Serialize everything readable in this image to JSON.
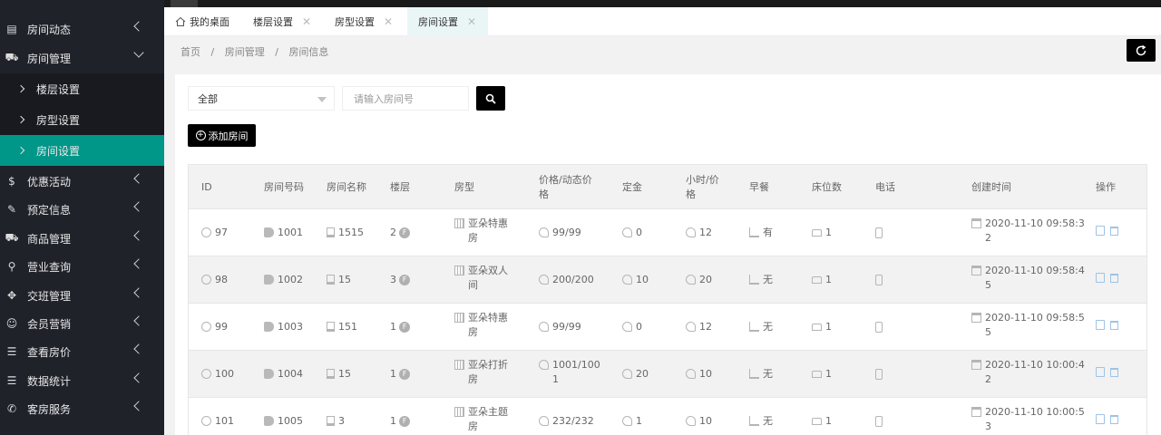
{
  "sidebar": {
    "items": [
      {
        "label": "房间动态",
        "icon": "calendar-icon",
        "expanded": false
      },
      {
        "label": "房间管理",
        "icon": "cart-icon",
        "expanded": true
      },
      {
        "label": "优惠活动",
        "icon": "dollar-icon",
        "expanded": false
      },
      {
        "label": "预定信息",
        "icon": "edit-icon",
        "expanded": false
      },
      {
        "label": "商品管理",
        "icon": "cart-icon",
        "expanded": false
      },
      {
        "label": "营业查询",
        "icon": "search-icon",
        "expanded": false
      },
      {
        "label": "交班管理",
        "icon": "handshake-icon",
        "expanded": false
      },
      {
        "label": "会员营销",
        "icon": "user-icon",
        "expanded": false
      },
      {
        "label": "查看房价",
        "icon": "list-icon",
        "expanded": false
      },
      {
        "label": "数据统计",
        "icon": "list-icon",
        "expanded": false
      },
      {
        "label": "客房服务",
        "icon": "phone-icon",
        "expanded": false
      }
    ],
    "subitems": [
      {
        "label": "楼层设置",
        "active": false
      },
      {
        "label": "房型设置",
        "active": false
      },
      {
        "label": "房间设置",
        "active": true
      }
    ]
  },
  "tabs": [
    {
      "label": "我的桌面",
      "closable": false
    },
    {
      "label": "楼层设置",
      "closable": true
    },
    {
      "label": "房型设置",
      "closable": true
    },
    {
      "label": "房间设置",
      "closable": true,
      "active": true
    }
  ],
  "breadcrumb": [
    "首页",
    "房间管理",
    "房间信息"
  ],
  "breadcrumb_sep": "/",
  "filters": {
    "select_value": "全部",
    "search_placeholder": "请输入房间号"
  },
  "add_button_label": "添加房间",
  "table": {
    "headers": {
      "id": "ID",
      "room_no": "房间号码",
      "room_name": "房间名称",
      "floor": "楼层",
      "room_type": "房型",
      "price_l1": "价格/动态价",
      "price_l2": "格",
      "deposit": "定金",
      "hourly_l1": "小时/价",
      "hourly_l2": "格",
      "breakfast": "早餐",
      "beds": "床位数",
      "phone": "电话",
      "created": "创建时间",
      "ops": "操作"
    },
    "floor_badge": "F",
    "rows": [
      {
        "id": "97",
        "room_no": "1001",
        "room_name": "1515",
        "floor": "2",
        "type_l1": "亚朵特惠",
        "type_l2": "房",
        "price_l1": "99/99",
        "price_l2": "",
        "deposit": "0",
        "hourly": "12",
        "breakfast": "有",
        "beds": "1",
        "phone": "",
        "created_l1": "2020-11-10 09:58:3",
        "created_l2": "2"
      },
      {
        "id": "98",
        "room_no": "1002",
        "room_name": "15",
        "floor": "3",
        "type_l1": "亚朵双人",
        "type_l2": "间",
        "price_l1": "200/200",
        "price_l2": "",
        "deposit": "10",
        "hourly": "20",
        "breakfast": "无",
        "beds": "1",
        "phone": "",
        "created_l1": "2020-11-10 09:58:4",
        "created_l2": "5"
      },
      {
        "id": "99",
        "room_no": "1003",
        "room_name": "151",
        "floor": "1",
        "type_l1": "亚朵特惠",
        "type_l2": "房",
        "price_l1": "99/99",
        "price_l2": "",
        "deposit": "0",
        "hourly": "12",
        "breakfast": "无",
        "beds": "1",
        "phone": "",
        "created_l1": "2020-11-10 09:58:5",
        "created_l2": "5"
      },
      {
        "id": "100",
        "room_no": "1004",
        "room_name": "15",
        "floor": "1",
        "type_l1": "亚朵打折",
        "type_l2": "房",
        "price_l1": "1001/100",
        "price_l2": "1",
        "deposit": "20",
        "hourly": "10",
        "breakfast": "无",
        "beds": "1",
        "phone": "",
        "created_l1": "2020-11-10 10:00:4",
        "created_l2": "2"
      },
      {
        "id": "101",
        "room_no": "1005",
        "room_name": "3",
        "floor": "1",
        "type_l1": "亚朵主题",
        "type_l2": "房",
        "price_l1": "232/232",
        "price_l2": "",
        "deposit": "1",
        "hourly": "10",
        "breakfast": "无",
        "beds": "1",
        "phone": "",
        "created_l1": "2020-11-10 10:00:5",
        "created_l2": "3"
      }
    ]
  },
  "colors": {
    "sidebar_bg": "#20222a",
    "active_green": "#009688",
    "button_black": "#000000"
  }
}
